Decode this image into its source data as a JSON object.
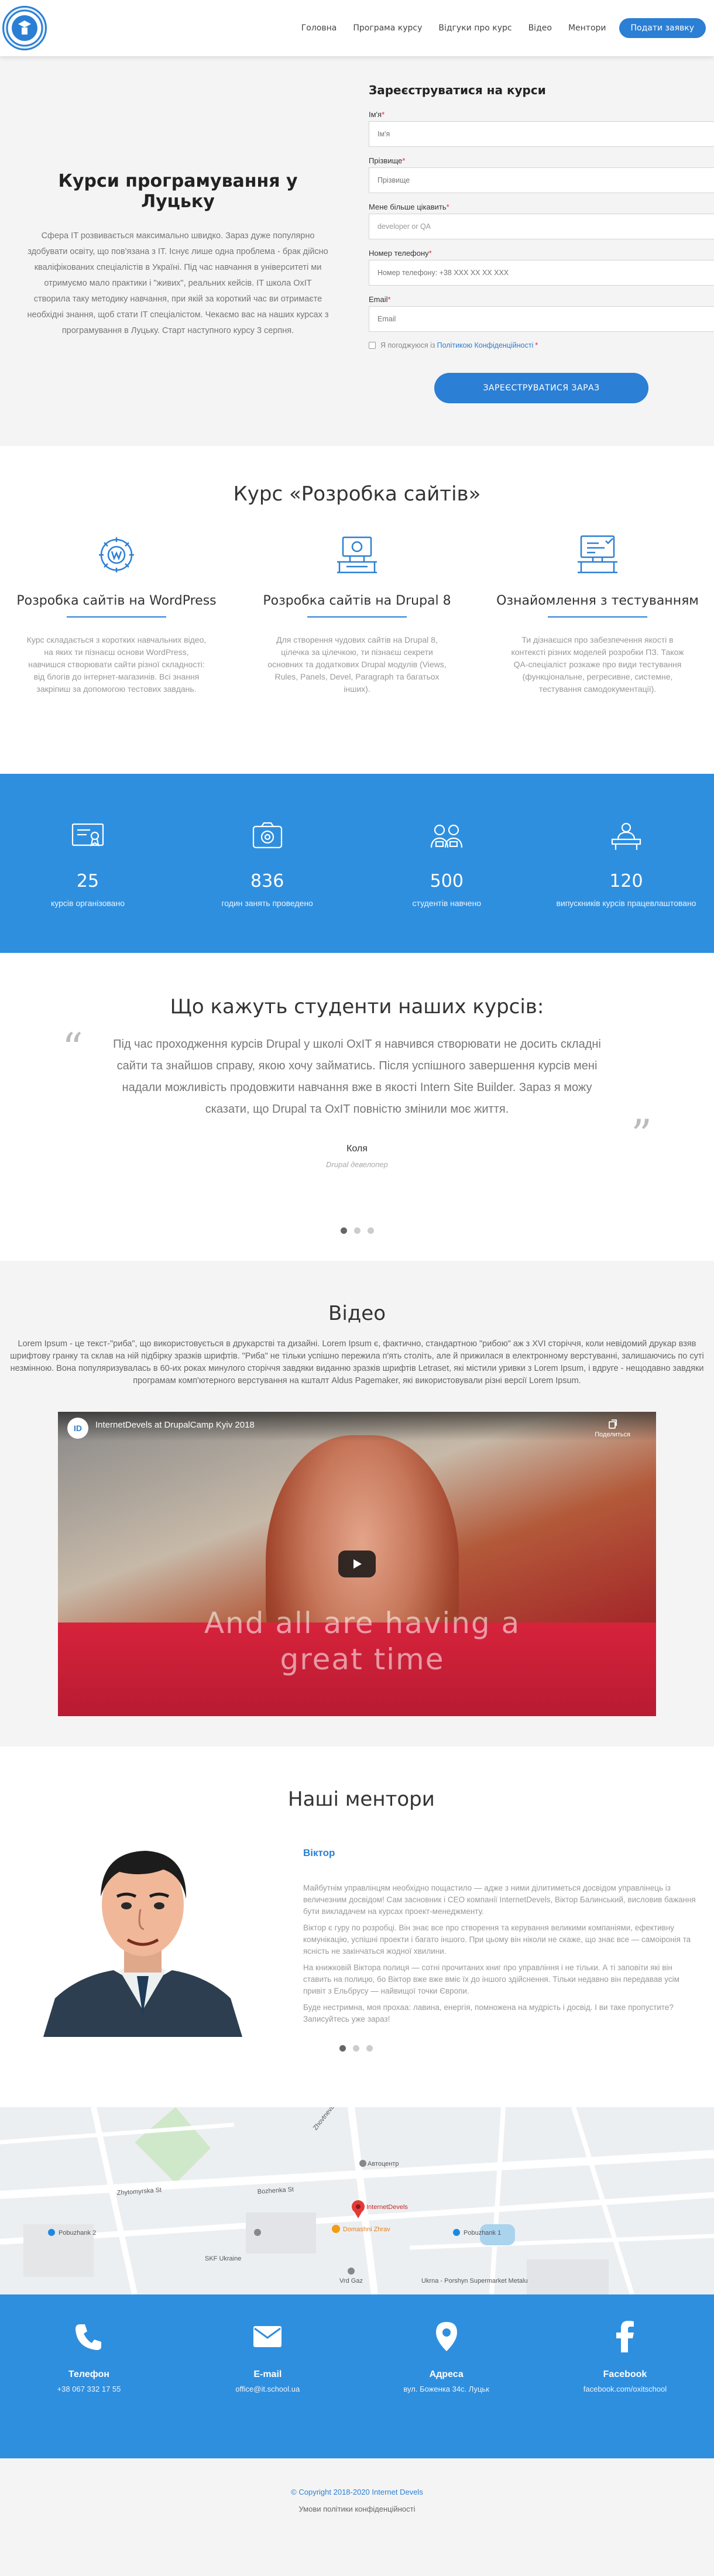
{
  "nav": {
    "items": [
      "Головна",
      "Програма курсу",
      "Відгуки про курс",
      "Відео",
      "Ментори"
    ],
    "cta": "Подати заявку"
  },
  "hero": {
    "title": "Курси програмування у Луцьку",
    "text": "Сфера IT розвивається максимально швидко. Зараз дуже популярно здобувати освіту, що пов'язана з IT. Існує лише одна проблема - брак дійсно кваліфікованих спеціалістів в Україні. Під час навчання в університеті ми отримуємо мало практики і \"живих\", реальних кейсів. IT школа OxIT створила таку методику навчання, при якій за короткий час ви отримаєте необхідні знання, щоб стати IT спеціалістом. Чекаємо вас на наших курсах з програмування в Луцьку. Старт наступного курсу 3 серпня."
  },
  "form": {
    "title": "Зареєструватися на курси",
    "name_label": "Ім'я",
    "name_placeholder": "Ім'я",
    "surname_label": "Прізвище",
    "surname_placeholder": "Прізвище",
    "interest_label": "Мене більше цікавить",
    "interest_value": "developer or QA",
    "phone_label": "Номер телефону",
    "phone_placeholder": "Номер телефону: +38 XXX XX XX XXX",
    "email_label": "Email",
    "email_placeholder": "Email",
    "consent_prefix": "Я погоджуюся із",
    "consent_link": "Політикою Конфіденційності",
    "submit": "ЗАРЕЄСТРУВАТИСЯ ЗАРАЗ"
  },
  "course": {
    "title": "Курс «Розробка сайтів»",
    "cards": [
      {
        "icon": "wordpress-gear-icon",
        "title": "Розробка сайтів на WordPress",
        "text": "Курс складається з коротких навчальних відео, на яких ти пізнаєш основи WordPress, навчишся створювати сайти різної складності: від блогів до інтернет-магазинів. Всі знання закріпиш за допомогою тестових завдань."
      },
      {
        "icon": "drupal-computer-icon",
        "title": "Розробка сайтів на Drupal 8",
        "text": "Для створення чудових сайтів на Drupal 8, цілечка за цілечкою, ти пізнаєш секрети основних та додаткових Drupal модулів (Views, Rules, Panels, Devel, Paragraph та багатьох інших)."
      },
      {
        "icon": "testing-computer-icon",
        "title": "Ознайомлення з тестуванням",
        "text": "Ти дізнаєшся про забезпечення якості в контексті різних моделей розробки ПЗ. Також QA-спеціаліст розкаже про види тестування (функціональне, регресивне, системне, тестування самодокументації)."
      }
    ]
  },
  "stats": [
    {
      "icon": "certificate-icon",
      "value": "25",
      "label": "курсів організовано"
    },
    {
      "icon": "camera-icon",
      "value": "836",
      "label": "годин занять проведено"
    },
    {
      "icon": "students-icon",
      "value": "500",
      "label": "студентів навчено"
    },
    {
      "icon": "teacher-icon",
      "value": "120",
      "label": "випускників курсів працевлаштовано"
    }
  ],
  "testimonials": {
    "title": "Що кажуть студенти наших курсів:",
    "quote": "Під час проходження курсів Drupal у школі OxIT я навчився створювати не досить складні сайти та знайшов справу, якою хочу займатись. Після успішного завершення курсів мені надали можливість продовжити навчання вже в якості Intern Site Builder. Зараз я можу сказати, що Drupal та OxIT повністю змінили моє життя.",
    "author": "Коля",
    "role": "Drupal девелопер"
  },
  "video": {
    "title": "Відео",
    "description": "Lorem Ipsum - це текст-\"риба\", що використовується в друкарстві та дизайні. Lorem Ipsum є, фактично, стандартною \"рибою\" аж з XVI сторіччя, коли невідомий друкар взяв шрифтову гранку та склав на ній підбірку зразків шрифтів. \"Риба\" не тільки успішно пережила п'ять століть, але й прижилася в електронному верстуванні, залишаючись по суті незмінною. Вона популяризувалась в 60-их роках минулого сторіччя завдяки виданню зразків шрифтів Letraset, які містили уривки з Lorem Ipsum, і вдруге - нещодавно завдяки програмам комп'ютерного верстування на кшталт Aldus Pagemaker, які використовували різні версії Lorem Ipsum.",
    "player_title": "InternetDevels at DrupalCamp Kyiv 2018",
    "player_logo": "ID",
    "share_label": "Поделиться",
    "overlay_text": "And all are having a great time"
  },
  "mentors": {
    "title": "Наші ментори",
    "name": "Віктор",
    "bio": [
      "Майбутнім управлінцям необхідно пощастило — адже з ними ділитиметься досвідом управлінець із величезним досвідом! Сам засновник і CEO компанії InternetDevels, Віктор Балинський, висловив бажання бути викладачем на курсах проект-менеджменту.",
      "Віктор є гуру по розробці. Він знає все про створення та керування великими компаніями, ефективну комунікацію, успішні проекти і багато іншого. При цьому він ніколи не скаже, що знає все — самоіронія та ясність не закінчаться жодної хвилини.",
      "На книжковій Віктора полиця — сотні прочитаних книг про управління і не тільки. А ті заповіти які він ставить на полицю, бо Віктор вже вже вміє їх до іншого здійснення. Тільки недавно він передавав усім привіт з Ельбрусу — найвищої точки Європи.",
      "Буде нестримна, моя прохаа: лавина, енергія, помножена на мудрість і досвід. І ви таке пропустите? Записуйтесь уже зараз!"
    ]
  },
  "map": {
    "labels": [
      "Zhovtneva St",
      "Zhytomyrska St",
      "Bozhenka St",
      "Автоцентр",
      "InternetDevels",
      "Domashni Zhrav",
      "Pobuzhank 2",
      "Pobuzhank 1",
      "SKF Ukraine",
      "Vrd Gaz",
      "Ukrnа - Porshyn Supermarket Metalu"
    ]
  },
  "contacts": [
    {
      "icon": "phone-icon",
      "title": "Телефон",
      "value": "+38 067 332 17 55"
    },
    {
      "icon": "mail-icon",
      "title": "E-mail",
      "value": "office@it.school.ua"
    },
    {
      "icon": "location-pin-icon",
      "title": "Адреса",
      "value": "вул. Боженка 34с. Луцьк"
    },
    {
      "icon": "facebook-icon",
      "title": "Facebook",
      "value": "facebook.com/oxitschool"
    }
  ],
  "footer": {
    "copyright": "© Copyright 2018-2020 Internet Devels",
    "privacy": "Умови політики конфіденційності"
  },
  "colors": {
    "accent": "#2b7fd4",
    "band": "#2f8fdf",
    "light_bg": "#f4f4f4"
  }
}
